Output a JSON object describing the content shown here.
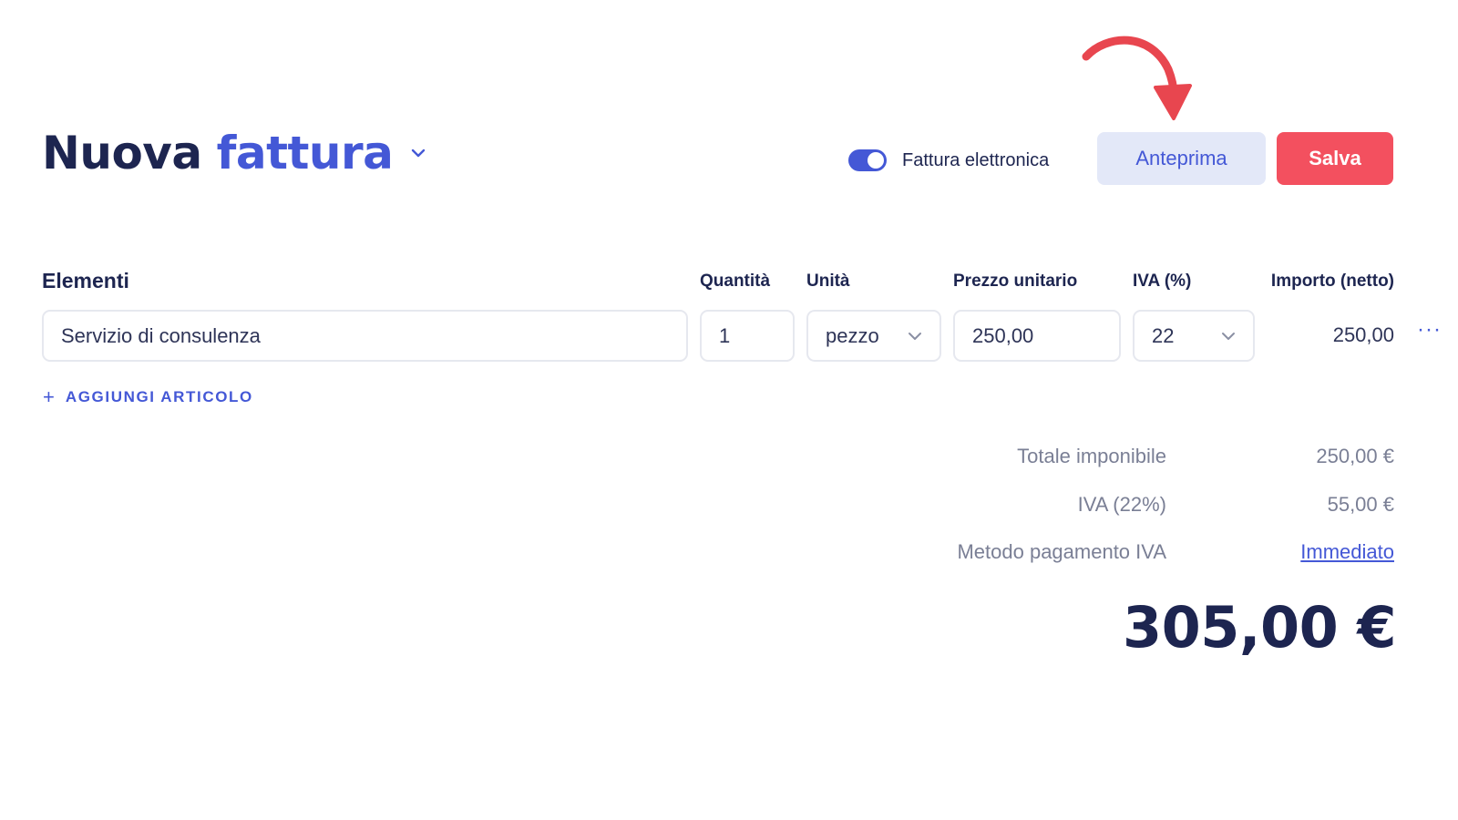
{
  "header": {
    "title_main": "Nuova",
    "title_accent": "fattura",
    "toggle_label": "Fattura elettronica",
    "preview_label": "Anteprima",
    "save_label": "Salva"
  },
  "table": {
    "columns": {
      "items": "Elementi",
      "quantity": "Quantità",
      "unit": "Unità",
      "unit_price": "Prezzo unitario",
      "vat": "IVA (%)",
      "amount": "Importo (netto)"
    },
    "rows": [
      {
        "description": "Servizio di consulenza",
        "quantity": "1",
        "unit": "pezzo",
        "unit_price": "250,00",
        "vat": "22",
        "amount": "250,00",
        "more": "···"
      }
    ],
    "add_item_icon": "+",
    "add_item_label": "AGGIUNGI ARTICOLO"
  },
  "summary": {
    "taxable_label": "Totale imponibile",
    "taxable_value": "250,00 €",
    "vat_label": "IVA (22%)",
    "vat_value": "55,00 €",
    "vat_method_label": "Metodo pagamento IVA",
    "vat_method_value": "Immediato",
    "grand_total": "305,00 €"
  },
  "colors": {
    "primary": "#4458d6",
    "dark": "#1d2550",
    "danger": "#f3505f",
    "muted": "#7a7f95",
    "arrow": "#e8464f"
  },
  "icons": {
    "title_dropdown": "chevron-down-icon",
    "arrow": "curved-arrow-icon",
    "select": "chevron-down-icon",
    "more": "more-horizontal-icon",
    "add": "plus-icon"
  },
  "toggle_on": true
}
